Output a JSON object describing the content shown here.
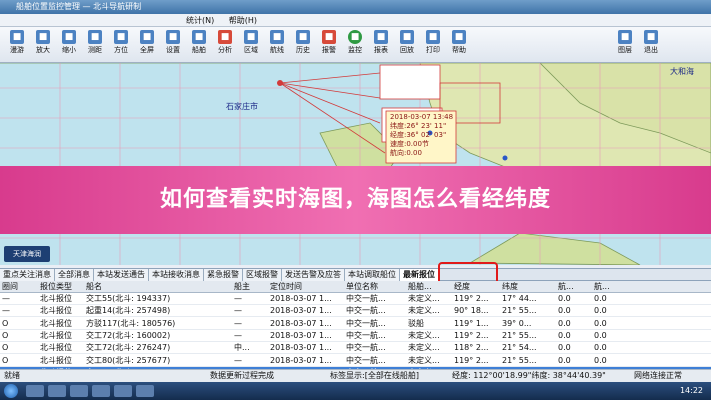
{
  "window": {
    "title": "船舶位置监控管理 — 北斗导航研制"
  },
  "menu": {
    "items": [
      "统计(N)",
      "帮助(H)"
    ]
  },
  "toolbar": {
    "buttons": [
      "漫游",
      "放大",
      "缩小",
      "测距",
      "方位",
      "全屏",
      "设置",
      "船舶",
      "分析",
      "区域",
      "航线",
      "历史",
      "报警",
      "监控",
      "报表",
      "回放",
      "打印",
      "帮助",
      "图层",
      "退出"
    ]
  },
  "map": {
    "label_1": "石家庄市",
    "label_2": "大和海",
    "info_lines": [
      "2018-03-07 13:48",
      "纬度:26° 23' 11\"",
      "经度:36° 02' 03\"",
      "速度:0.00节",
      "航向:0.00"
    ]
  },
  "banner": {
    "text": "如何查看实时海图，海图怎么看经纬度"
  },
  "logo": {
    "text": "天津海润"
  },
  "tabs": [
    "重点关注消息",
    "全部消息",
    "本站发送通告",
    "本站接收消息",
    "紧急报警",
    "区域报警",
    "发送告警及应答",
    "本站调取船位",
    "最新报位"
  ],
  "grid": {
    "columns": [
      "圈间",
      "报位类型",
      "船名",
      "船主",
      "定位时间",
      "单位名称",
      "船舶...",
      "经度",
      "纬度",
      "航...",
      "航..."
    ],
    "rows": [
      [
        "—",
        "北斗报位",
        "交工55(北斗: 194337)",
        "—",
        "2018-03-07 1...",
        "中交一航...",
        "未定义...",
        "119° 2...",
        "17° 44...",
        "0.0",
        "0.0"
      ],
      [
        "—",
        "北斗报位",
        "起重14(北斗: 257498)",
        "—",
        "2018-03-07 1...",
        "中交一航...",
        "未定义...",
        "90° 18...",
        "21° 55...",
        "0.0",
        "0.0"
      ],
      [
        "O",
        "北斗报位",
        "方驳117(北斗: 180576)",
        "—",
        "2018-03-07 1...",
        "中交一航...",
        "驳船",
        "119° 1...",
        "39° 0...",
        "0.0",
        "0.0"
      ],
      [
        "O",
        "北斗报位",
        "交工72(北斗: 160002)",
        "—",
        "2018-03-07 1...",
        "中交一航...",
        "未定义...",
        "119° 2...",
        "21° 55...",
        "0.0",
        "0.0"
      ],
      [
        "O",
        "北斗报位",
        "交工72(北斗: 276247)",
        "中...",
        "2018-03-07 1...",
        "中交一航...",
        "未定义...",
        "118° 2...",
        "21° 54...",
        "0.0",
        "0.0"
      ],
      [
        "O",
        "北斗报位",
        "交工80(北斗: 257677)",
        "—",
        "2018-03-07 1...",
        "中交一航...",
        "未定义...",
        "119° 2...",
        "21° 55...",
        "0.0",
        "0.0"
      ],
      [
        "O",
        "北斗报位",
        "交工79(北斗: 258020)",
        "—",
        "2018-03-07 1...",
        "中交一航...",
        "未定义...",
        "113° 4...",
        "23° 44...",
        "0.0",
        "0.0"
      ]
    ]
  },
  "status": {
    "left": "就绪",
    "center": "数据更新过程完成",
    "mid": "标签显示:[全部在线船舶]",
    "coords": "经度: 112°00'18.99\"纬度: 38°44'40.39\"",
    "right": "网络连接正常"
  },
  "taskbar": {
    "clock": "14:22"
  }
}
